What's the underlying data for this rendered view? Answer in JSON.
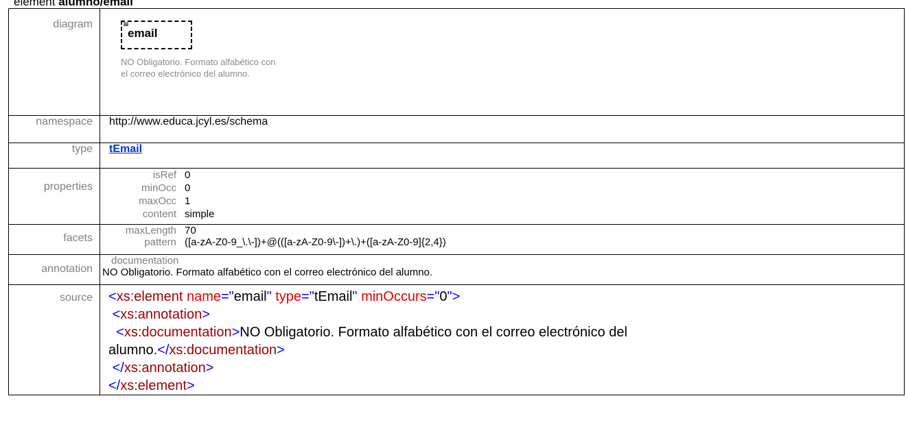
{
  "heading": {
    "prefix": "element ",
    "name": "alumno/email"
  },
  "rows": {
    "diagram": {
      "label": "diagram",
      "element_name": "email",
      "documentation": "NO Obligatorio. Formato alfabético con el correo electrónico del alumno."
    },
    "namespace": {
      "label": "namespace",
      "value": "http://www.educa.jcyl.es/schema"
    },
    "type": {
      "label": "type",
      "value": "tEmail"
    },
    "properties": {
      "label": "properties",
      "items": [
        {
          "key": "isRef",
          "value": "0"
        },
        {
          "key": "minOcc",
          "value": "0"
        },
        {
          "key": "maxOcc",
          "value": "1"
        },
        {
          "key": "content",
          "value": "simple"
        }
      ]
    },
    "facets": {
      "label": "facets",
      "items": [
        {
          "key": "maxLength",
          "value": "70"
        },
        {
          "key": "pattern",
          "value": "([a-zA-Z0-9_\\.\\-])+@(([a-zA-Z0-9\\-])+\\.)+([a-zA-Z0-9]{2,4})"
        }
      ]
    },
    "annotation": {
      "label": "annotation",
      "key": "documentation",
      "text": "NO Obligatorio. Formato alfabético con el correo electrónico del alumno."
    },
    "source": {
      "label": "source",
      "line1": {
        "open": "<",
        "tag": "xs:element",
        "attr1": " name",
        "eq1": "=\"",
        "val1": "email",
        "q1": "\"",
        "attr2": " type",
        "eq2": "=\"",
        "val2": "tEmail",
        "q2": "\"",
        "attr3": " minOccurs",
        "eq3": "=\"",
        "val3": "0",
        "close": "\">"
      },
      "line2": {
        "indent": " ",
        "open": "<",
        "tag": "xs:annotation",
        "close": ">"
      },
      "line3": {
        "indent": "  ",
        "open": "<",
        "tag": "xs:documentation",
        "close": ">",
        "text": "NO Obligatorio. Formato alfabético con el correo electrónico del"
      },
      "line4": {
        "text": "alumno.",
        "open": "</",
        "tag": "xs:documentation",
        "close": ">"
      },
      "line5": {
        "indent": " ",
        "open": "</",
        "tag": "xs:annotation",
        "close": ">"
      },
      "line6": {
        "open": "</",
        "tag": "xs:element",
        "close": ">"
      }
    }
  },
  "colors": {
    "label_gray": "#808080",
    "link_blue": "#0033cc",
    "xml_tag": "#9b0000",
    "xml_attr": "#e00000",
    "xml_punct": "#0000ff"
  }
}
